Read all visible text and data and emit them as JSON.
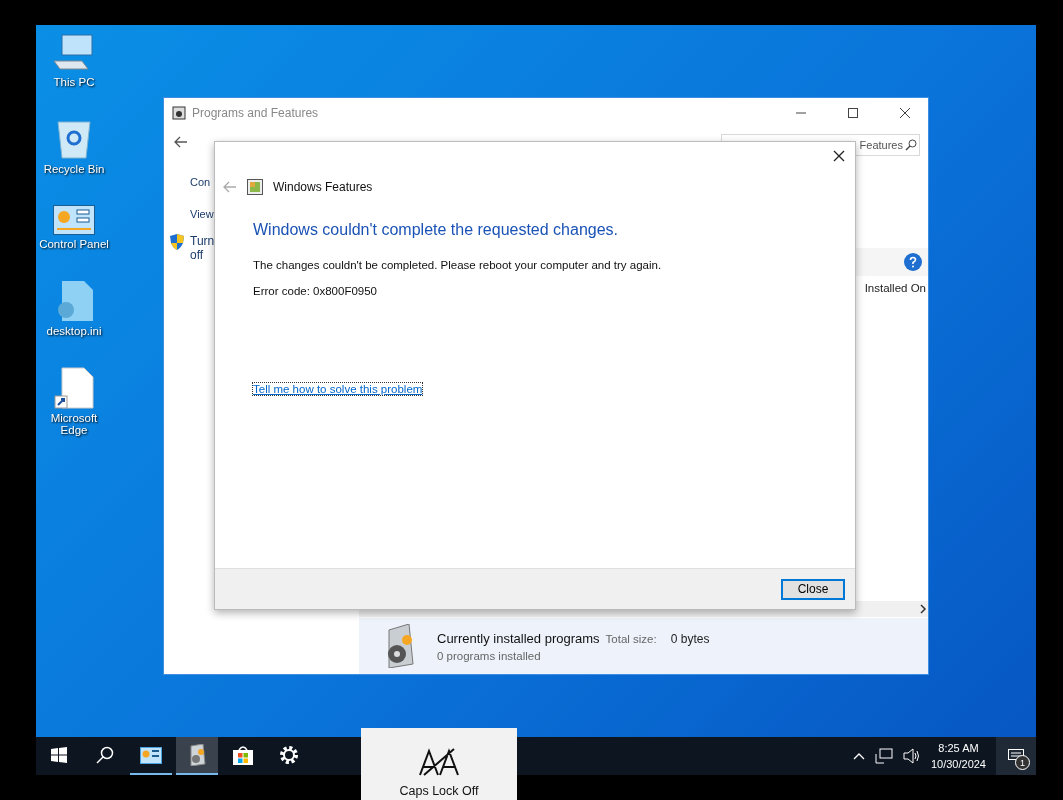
{
  "desktop_icons": [
    {
      "label": "This PC",
      "kind": "pc"
    },
    {
      "label": "Recycle Bin",
      "kind": "bin"
    },
    {
      "label": "Control Panel",
      "kind": "control"
    },
    {
      "label": "desktop.ini",
      "kind": "ini"
    },
    {
      "label": "Microsoft Edge",
      "kind": "shortcut"
    }
  ],
  "explorer": {
    "title": "Programs and Features",
    "search_placeholder": "Features",
    "sidebar": [
      "Con",
      "View"
    ],
    "sidebar_task": "Turn off",
    "column_header": "Installed On",
    "details": {
      "title": "Currently installed programs",
      "size_label": "Total size:",
      "size_value": "0 bytes",
      "count": "0 programs installed"
    }
  },
  "dialog": {
    "title": "Windows Features",
    "heading": "Windows couldn't complete the requested changes.",
    "message": "The changes couldn't be completed. Please reboot your computer and try again.",
    "error": "Error code: 0x800F0950",
    "link": "Tell me how to solve this problem",
    "button": "Close"
  },
  "taskbar": {
    "items": [
      {
        "kind": "start",
        "running": false,
        "selected": false
      },
      {
        "kind": "search",
        "running": false,
        "selected": false
      },
      {
        "kind": "control",
        "running": true,
        "selected": false
      },
      {
        "kind": "programs",
        "running": true,
        "selected": true
      },
      {
        "kind": "store",
        "running": false,
        "selected": false
      },
      {
        "kind": "settings",
        "running": false,
        "selected": false
      }
    ],
    "time": "8:25 AM",
    "date": "10/30/2024",
    "notification_count": "1"
  },
  "osd": {
    "label": "Caps Lock Off"
  }
}
